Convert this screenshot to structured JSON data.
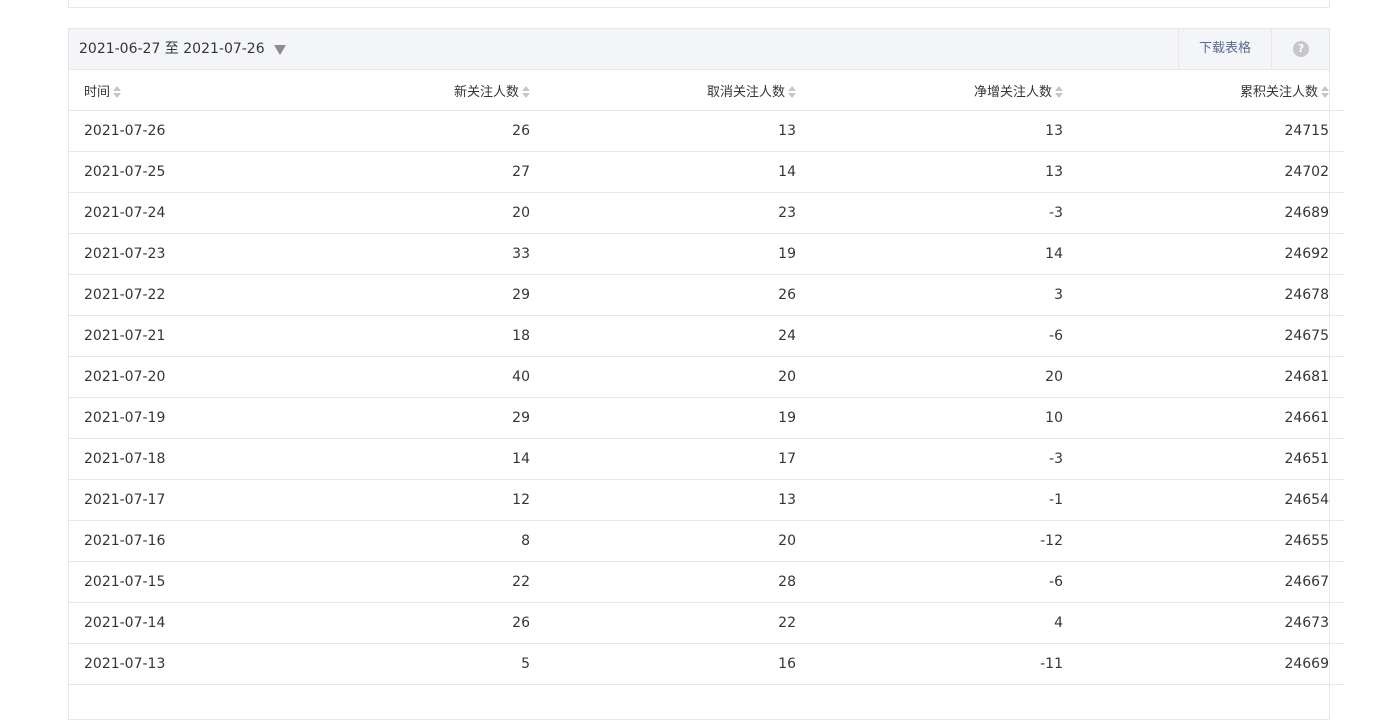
{
  "toolbar": {
    "date_range": "2021-06-27 至 2021-07-26",
    "download_label": "下载表格",
    "help_symbol": "?"
  },
  "table": {
    "columns": [
      "时间",
      "新关注人数",
      "取消关注人数",
      "净增关注人数",
      "累积关注人数"
    ],
    "rows": [
      [
        "2021-07-26",
        "26",
        "13",
        "13",
        "24715"
      ],
      [
        "2021-07-25",
        "27",
        "14",
        "13",
        "24702"
      ],
      [
        "2021-07-24",
        "20",
        "23",
        "-3",
        "24689"
      ],
      [
        "2021-07-23",
        "33",
        "19",
        "14",
        "24692"
      ],
      [
        "2021-07-22",
        "29",
        "26",
        "3",
        "24678"
      ],
      [
        "2021-07-21",
        "18",
        "24",
        "-6",
        "24675"
      ],
      [
        "2021-07-20",
        "40",
        "20",
        "20",
        "24681"
      ],
      [
        "2021-07-19",
        "29",
        "19",
        "10",
        "24661"
      ],
      [
        "2021-07-18",
        "14",
        "17",
        "-3",
        "24651"
      ],
      [
        "2021-07-17",
        "12",
        "13",
        "-1",
        "24654"
      ],
      [
        "2021-07-16",
        "8",
        "20",
        "-12",
        "24655"
      ],
      [
        "2021-07-15",
        "22",
        "28",
        "-6",
        "24667"
      ],
      [
        "2021-07-14",
        "26",
        "22",
        "4",
        "24673"
      ],
      [
        "2021-07-13",
        "5",
        "16",
        "-11",
        "24669"
      ]
    ]
  },
  "colors": {
    "link": "#576b95",
    "toolbar_bg": "#f4f5f9",
    "border": "#e7e7eb"
  }
}
